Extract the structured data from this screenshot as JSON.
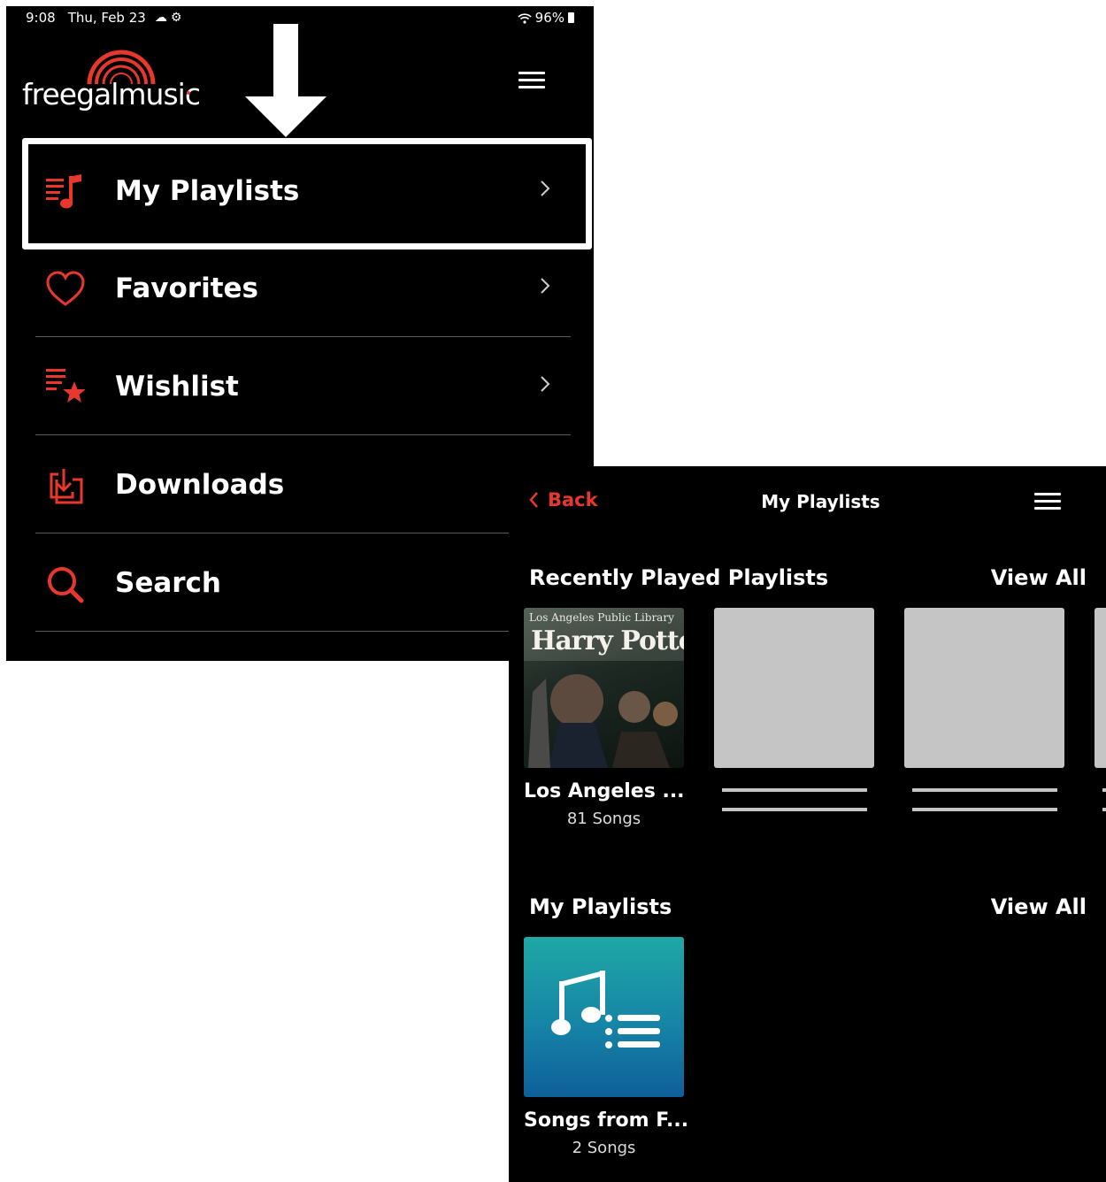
{
  "status_bar": {
    "time": "9:08",
    "date": "Thu, Feb 23",
    "battery": "96%"
  },
  "menu_screen": {
    "logo_text": "freegalmusic",
    "accent_color": "#e8372c",
    "items": [
      {
        "label": "My Playlists",
        "icon": "playlist-icon"
      },
      {
        "label": "Favorites",
        "icon": "heart-icon"
      },
      {
        "label": "Wishlist",
        "icon": "wishlist-star-icon"
      },
      {
        "label": "Downloads",
        "icon": "download-icon"
      },
      {
        "label": "Search",
        "icon": "search-icon"
      }
    ]
  },
  "playlists_screen": {
    "back_label": "Back",
    "title": "My Playlists",
    "recent_section": {
      "title": "Recently Played Playlists",
      "view_all": "View All",
      "cards": [
        {
          "title": "Los Angeles ...",
          "subtitle": "81 Songs",
          "art_line1": "Los Angeles Public Library",
          "art_line2": "Harry Potter"
        }
      ]
    },
    "my_section": {
      "title": "My Playlists",
      "view_all": "View All",
      "cards": [
        {
          "title": "Songs from F...",
          "subtitle": "2 Songs"
        }
      ]
    }
  }
}
